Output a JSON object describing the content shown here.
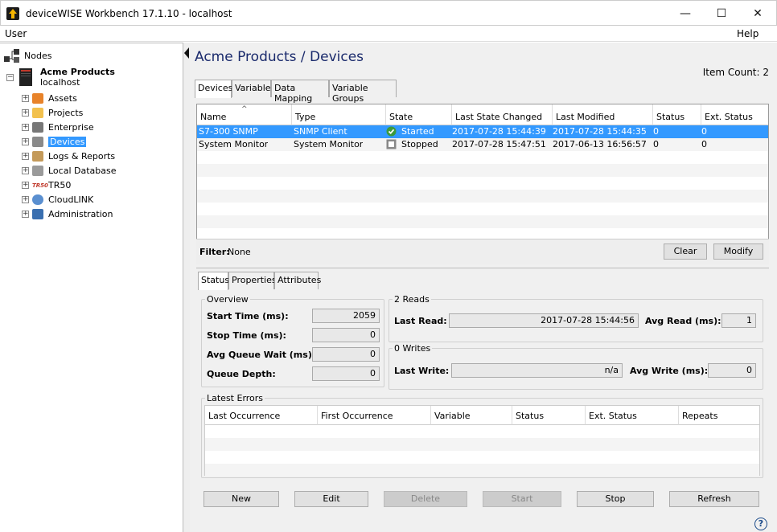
{
  "window": {
    "title": "deviceWISE Workbench 17.1.10  -  localhost",
    "minimize": "—",
    "maximize": "☐",
    "close": "✕"
  },
  "menu": {
    "user": "User",
    "help": "Help"
  },
  "tree": {
    "root": "Nodes",
    "server_name": "Acme Products",
    "server_host": "localhost",
    "items": [
      {
        "label": "Assets",
        "icon": "assets-icon"
      },
      {
        "label": "Projects",
        "icon": "folder-icon"
      },
      {
        "label": "Enterprise",
        "icon": "enterprise-icon"
      },
      {
        "label": "Devices",
        "icon": "devices-icon"
      },
      {
        "label": "Logs & Reports",
        "icon": "logs-icon"
      },
      {
        "label": "Local Database",
        "icon": "database-icon"
      },
      {
        "label": "TR50",
        "icon": "tr50-icon"
      },
      {
        "label": "CloudLINK",
        "icon": "cloud-icon"
      },
      {
        "label": "Administration",
        "icon": "admin-icon"
      }
    ],
    "expander": "+",
    "collapse": "−",
    "tr50_logo": "TR50"
  },
  "page": {
    "title": "Acme Products / Devices",
    "item_count": "Item Count: 2"
  },
  "tabs": [
    "Devices",
    "Variables",
    "Data Mapping",
    "Variable Groups"
  ],
  "device_table": {
    "columns": [
      "Name",
      "Type",
      "State",
      "Last State Changed",
      "Last Modified",
      "Status",
      "Ext. Status"
    ],
    "rows": [
      {
        "name": "S7-300 SNMP",
        "type": "SNMP Client",
        "state": "Started",
        "last_state_changed": "2017-07-28 15:44:39",
        "last_modified": "2017-07-28 15:44:35",
        "status": "0",
        "ext_status": "0"
      },
      {
        "name": "System Monitor",
        "type": "System Monitor",
        "state": "Stopped",
        "last_state_changed": "2017-07-28 15:47:51",
        "last_modified": "2017-06-13 16:56:57",
        "status": "0",
        "ext_status": "0"
      }
    ]
  },
  "filter": {
    "label": "Filter:",
    "value": "None",
    "clear": "Clear",
    "modify": "Modify"
  },
  "detail_tabs": [
    "Status",
    "Properties",
    "Attributes"
  ],
  "overview": {
    "legend": "Overview",
    "start_time_label": "Start Time (ms):",
    "start_time": "2059",
    "stop_time_label": "Stop Time (ms):",
    "stop_time": "0",
    "avg_queue_label": "Avg Queue Wait (ms):",
    "avg_queue": "0",
    "queue_depth_label": "Queue Depth:",
    "queue_depth": "0"
  },
  "reads": {
    "legend": "2 Reads",
    "last_read_label": "Last Read:",
    "last_read": "2017-07-28 15:44:56",
    "avg_read_label": "Avg Read (ms):",
    "avg_read": "1"
  },
  "writes": {
    "legend": "0 Writes",
    "last_write_label": "Last Write:",
    "last_write": "n/a",
    "avg_write_label": "Avg Write (ms):",
    "avg_write": "0"
  },
  "errors": {
    "legend": "Latest Errors",
    "columns": [
      "Last Occurrence",
      "First Occurrence",
      "Variable",
      "Status",
      "Ext. Status",
      "Repeats"
    ]
  },
  "actions": {
    "new": "New",
    "edit": "Edit",
    "delete": "Delete",
    "start": "Start",
    "stop": "Stop",
    "refresh": "Refresh"
  },
  "help_icon": "?",
  "colors": {
    "selection": "#3399ff",
    "title": "#1a2a6c",
    "started": "#3c9a3c"
  }
}
